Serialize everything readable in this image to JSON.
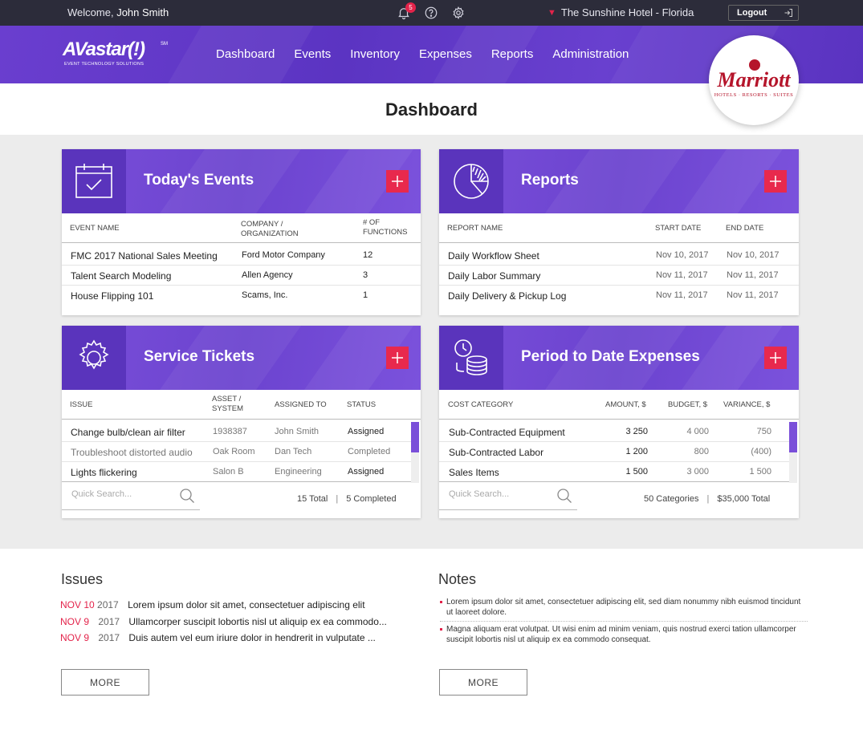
{
  "topbar": {
    "welcome_prefix": "Welcome,",
    "user_name": "John Smith",
    "notification_count": "5",
    "hotel": "The Sunshine Hotel - Florida",
    "logout_label": "Logout",
    "icons": [
      "bell-icon",
      "help-icon",
      "gear-icon",
      "logout-arrow-icon"
    ]
  },
  "brand": {
    "name": "AVastar(!)",
    "service_mark": "SM",
    "tagline": "EVENT TECHNOLOGY SOLUTIONS"
  },
  "nav": {
    "items": [
      "Dashboard",
      "Events",
      "Inventory",
      "Expenses",
      "Reports",
      "Administration"
    ]
  },
  "hotel_logo": {
    "name": "Marriott",
    "sub": "HOTELS · RESORTS · SUITES"
  },
  "page": {
    "title": "Dashboard"
  },
  "events": {
    "title": "Today's Events",
    "columns": [
      "EVENT NAME",
      "COMPANY / ORGANIZATION",
      "# OF FUNCTIONS"
    ],
    "rows": [
      [
        "FMC 2017 National Sales Meeting",
        "Ford Motor Company",
        "12"
      ],
      [
        "Talent Search Modeling",
        "Allen Agency",
        "3"
      ],
      [
        "House Flipping 101",
        "Scams, Inc.",
        "1"
      ]
    ]
  },
  "reports": {
    "title": "Reports",
    "columns": [
      "REPORT NAME",
      "START DATE",
      "END DATE"
    ],
    "rows": [
      [
        "Daily Workflow Sheet",
        "Nov 10, 2017",
        "Nov 10, 2017"
      ],
      [
        "Daily Labor Summary",
        "Nov 11, 2017",
        "Nov 11, 2017"
      ],
      [
        "Daily Delivery & Pickup Log",
        "Nov 11, 2017",
        "Nov 11, 2017"
      ]
    ]
  },
  "tickets": {
    "title": "Service Tickets",
    "columns": [
      "ISSUE",
      "ASSET / SYSTEM",
      "ASSIGNED TO",
      "STATUS"
    ],
    "rows": [
      [
        "Change bulb/clean air filter",
        "1938387",
        "John Smith",
        "Assigned"
      ],
      [
        "Troubleshoot distorted audio",
        "Oak Room",
        "Dan Tech",
        "Completed"
      ],
      [
        "Lights flickering",
        "Salon B",
        "Engineering",
        "Assigned"
      ]
    ],
    "search_placeholder": "Quick Search...",
    "total": "15 Total",
    "completed": "5 Completed"
  },
  "expenses": {
    "title": "Period to Date Expenses",
    "columns": [
      "COST CATEGORY",
      "AMOUNT, $",
      "BUDGET, $",
      "VARIANCE, $"
    ],
    "rows": [
      [
        "Sub-Contracted Equipment",
        "3 250",
        "4 000",
        "750"
      ],
      [
        "Sub-Contracted Labor",
        "1 200",
        "800",
        "(400)"
      ],
      [
        "Sales Items",
        "1 500",
        "3 000",
        "1 500"
      ]
    ],
    "search_placeholder": "Quick Search...",
    "categories": "50 Categories",
    "total": "$35,000 Total"
  },
  "issues": {
    "title": "Issues",
    "items": [
      {
        "date": "NOV 10",
        "year": "2017",
        "text": "Lorem ipsum dolor sit amet, consectetuer adipiscing elit"
      },
      {
        "date": "NOV 9",
        "year": "2017",
        "text": "Ullamcorper suscipit lobortis nisl ut aliquip ex ea commodo..."
      },
      {
        "date": "NOV 9",
        "year": "2017",
        "text": "Duis autem vel eum iriure dolor in hendrerit in vulputate ..."
      }
    ],
    "more_label": "MORE"
  },
  "notes": {
    "title": "Notes",
    "items": [
      "Lorem ipsum dolor sit amet, consectetuer adipiscing elit, sed diam nonummy nibh euismod tincidunt ut laoreet dolore.",
      "Magna aliquam erat volutpat. Ut wisi enim ad minim veniam, quis nostrud exerci tation ullamcorper suscipit lobortis nisl ut aliquip ex ea commodo consequat."
    ],
    "more_label": "MORE"
  },
  "colors": {
    "topbar": "#2c2c3a",
    "brand_purple": "#6a3ecf",
    "accent_red": "#e8294d",
    "marriott_red": "#b5152b"
  }
}
